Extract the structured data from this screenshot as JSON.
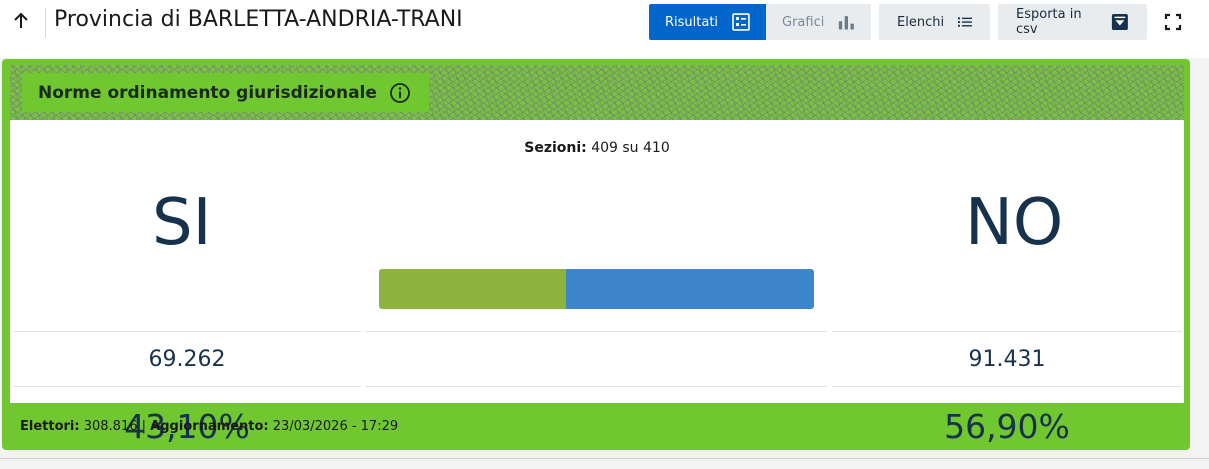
{
  "header": {
    "title": "Provincia di BARLETTA-ANDRIA-TRANI",
    "tabs": [
      {
        "label": "Risultati",
        "icon": "list-details-icon",
        "active": true
      },
      {
        "label": "Grafici",
        "icon": "bar-chart-icon",
        "active": false
      }
    ],
    "elenchi_label": "Elenchi",
    "export_label": "Esporta in csv"
  },
  "referendum": {
    "title": "Norme ordinamento giurisdizionale",
    "sezioni_label": "Sezioni:",
    "sezioni_value": "409 su 410",
    "si": {
      "label": "SI",
      "votes": "69.262",
      "percent": "43,10%",
      "share": 0.431,
      "color": "#8db43e"
    },
    "no": {
      "label": "NO",
      "votes": "91.431",
      "percent": "56,90%",
      "share": 0.569,
      "color": "#3e86cc"
    }
  },
  "footer": {
    "elettori_label": "Elettori:",
    "elettori_value": "308.816",
    "separator": "|",
    "aggiornamento_label": "Aggiornamento:",
    "aggiornamento_value": "23/03/2026 - 17:29"
  },
  "colors": {
    "accent": "#0066cc",
    "card_green": "#70c72f",
    "text_dark": "#17324d"
  }
}
